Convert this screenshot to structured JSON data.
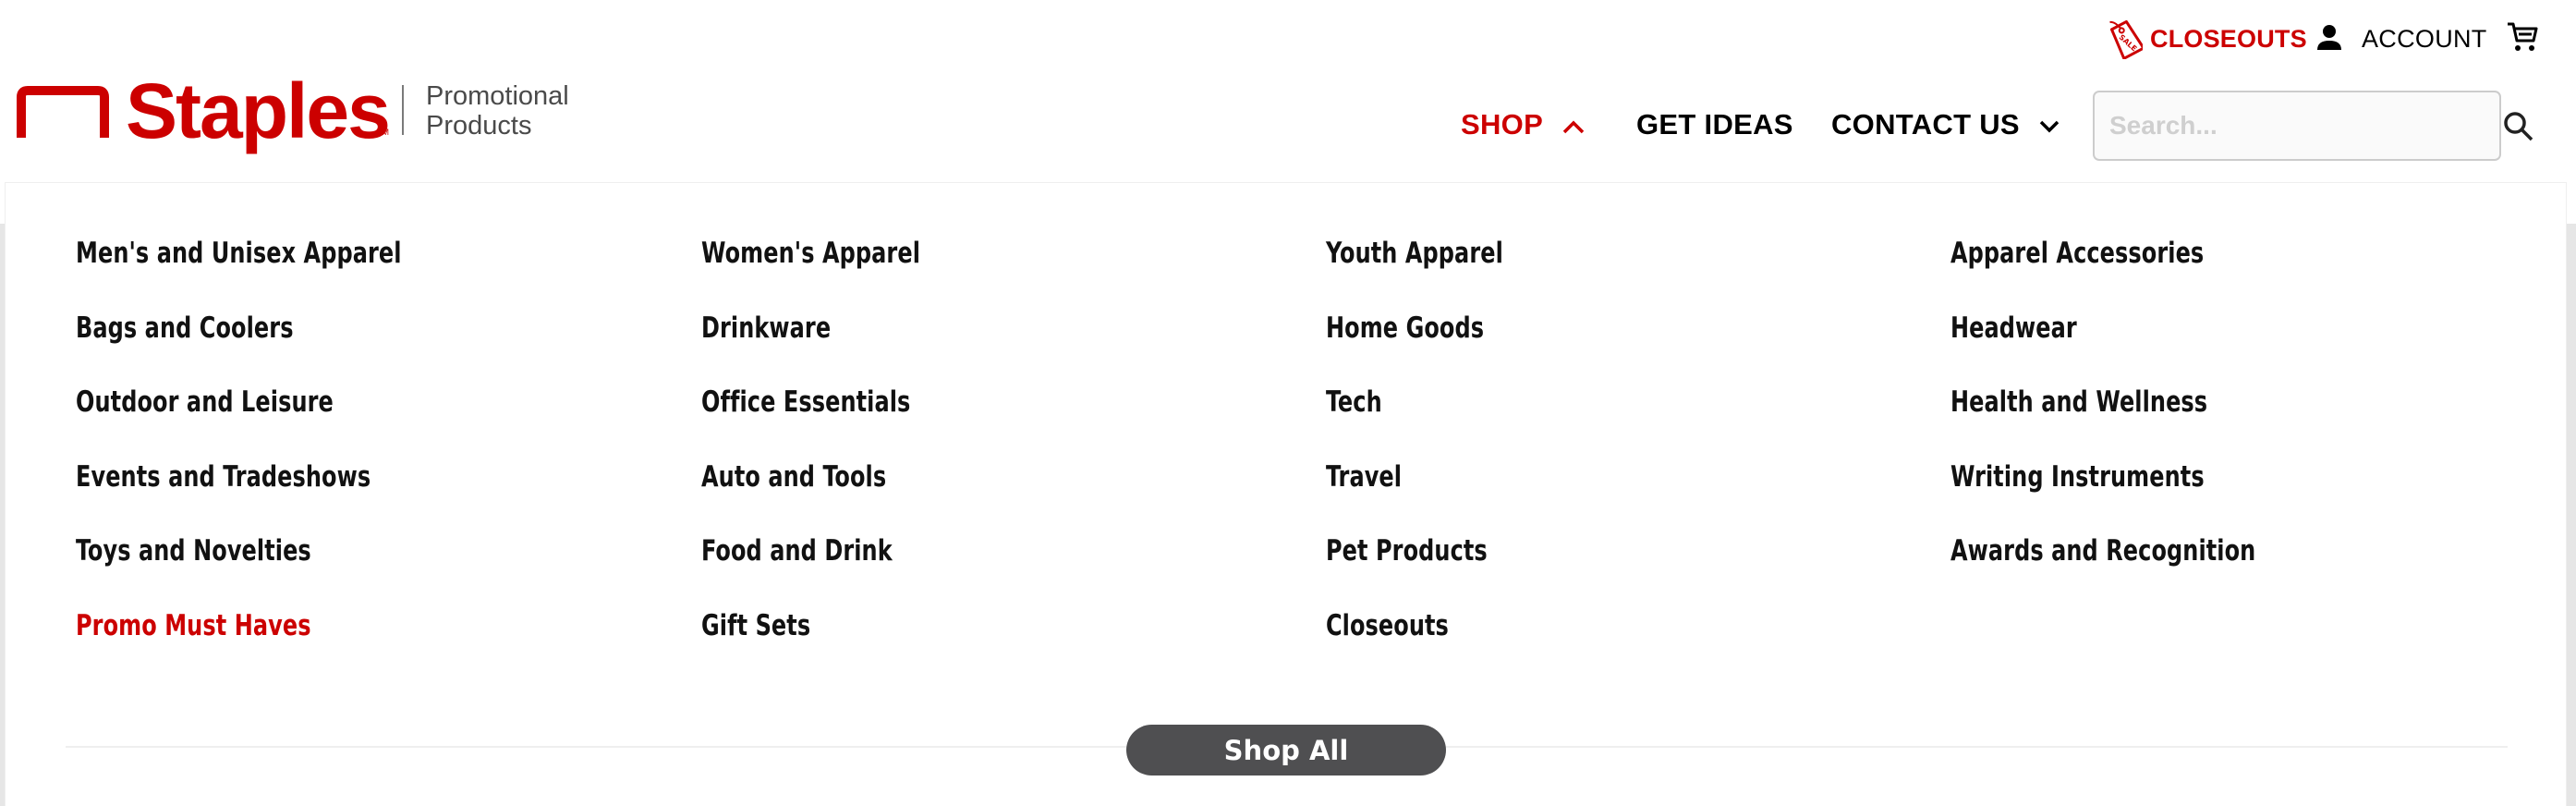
{
  "utility": {
    "closeouts_label": "CLOSEOUTS",
    "closeouts_icon": "sale-tag-icon",
    "account_label": "ACCOUNT",
    "account_icon": "person-icon",
    "cart_icon": "cart-icon"
  },
  "logo": {
    "brand": "Staples",
    "trademark": "TM",
    "subtitle_line1": "Promotional",
    "subtitle_line2": "Products"
  },
  "nav": {
    "shop_label": "SHOP",
    "ideas_label": "GET IDEAS",
    "contact_label": "CONTACT US"
  },
  "search": {
    "placeholder": "Search...",
    "value": ""
  },
  "menu": {
    "columns": [
      [
        "Men's and Unisex Apparel",
        "Bags and Coolers",
        "Outdoor and Leisure",
        "Events and Tradeshows",
        "Toys and Novelties",
        "Promo Must Haves"
      ],
      [
        "Women's Apparel",
        "Drinkware",
        "Office Essentials",
        "Auto and Tools",
        "Food and Drink",
        "Gift Sets"
      ],
      [
        "Youth Apparel",
        "Home Goods",
        "Tech",
        "Travel",
        "Pet Products",
        "Closeouts"
      ],
      [
        "Apparel Accessories",
        "Headwear",
        "Health and Wellness",
        "Writing Instruments",
        "Awards and Recognition"
      ]
    ],
    "shop_all_label": "Shop All"
  },
  "colors": {
    "brand_red": "#cc0000",
    "button_gray": "#4f4f51"
  }
}
